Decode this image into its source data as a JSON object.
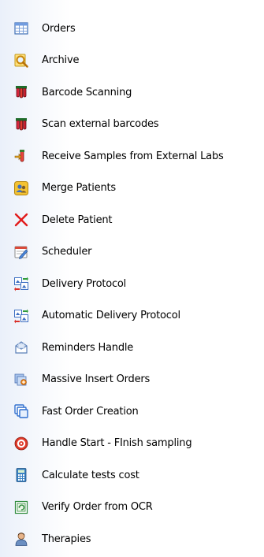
{
  "menu": {
    "items": [
      {
        "label": "Orders",
        "icon": "table-grid-icon"
      },
      {
        "label": "Archive",
        "icon": "magnifier-icon"
      },
      {
        "label": "Barcode Scanning",
        "icon": "test-tubes-icon"
      },
      {
        "label": "Scan external barcodes",
        "icon": "test-tubes-icon"
      },
      {
        "label": "Receive Samples from External Labs",
        "icon": "receive-samples-icon"
      },
      {
        "label": "Merge Patients",
        "icon": "merge-patients-icon"
      },
      {
        "label": "Delete Patient",
        "icon": "red-x-icon"
      },
      {
        "label": "Scheduler",
        "icon": "scheduler-icon"
      },
      {
        "label": "Delivery Protocol",
        "icon": "delivery-protocol-icon"
      },
      {
        "label": "Automatic Delivery Protocol",
        "icon": "automatic-delivery-icon"
      },
      {
        "label": "Reminders Handle",
        "icon": "reminders-icon"
      },
      {
        "label": "Massive Insert Orders",
        "icon": "massive-insert-icon"
      },
      {
        "label": "Fast Order Creation",
        "icon": "fast-order-icon"
      },
      {
        "label": "Handle Start - FInish sampling",
        "icon": "target-icon"
      },
      {
        "label": "Calculate tests cost",
        "icon": "calculator-icon"
      },
      {
        "label": "Verify Order from OCR",
        "icon": "verify-ocr-icon"
      },
      {
        "label": "Therapies",
        "icon": "person-icon"
      }
    ]
  }
}
